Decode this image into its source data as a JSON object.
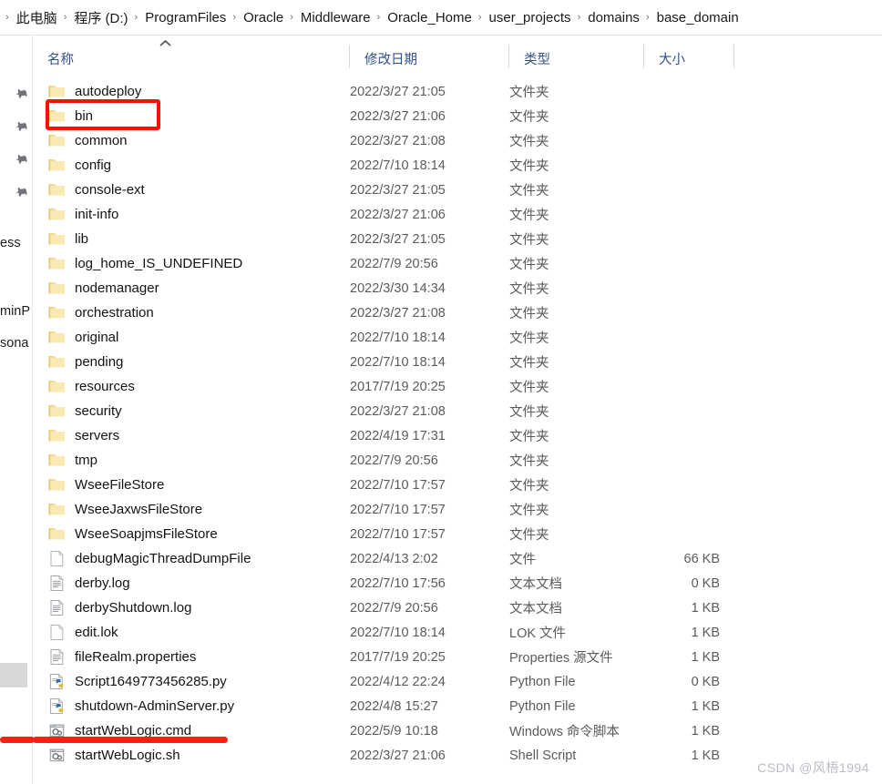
{
  "breadcrumb": {
    "separator": "›",
    "items": [
      "此电脑",
      "程序 (D:)",
      "ProgramFiles",
      "Oracle",
      "Middleware",
      "Oracle_Home",
      "user_projects",
      "domains",
      "base_domain"
    ]
  },
  "nav_pane": {
    "pin_icon": "pin-icon",
    "pin_count": 4,
    "fragments": [
      "ess",
      "minP",
      "sona"
    ]
  },
  "columns": {
    "name": "名称",
    "date_modified": "修改日期",
    "type": "类型",
    "size": "大小",
    "sort_arrow": "︿"
  },
  "files": [
    {
      "name": "autodeploy",
      "icon": "folder-icon",
      "date": "2022/3/27 21:05",
      "type": "文件夹",
      "size": ""
    },
    {
      "name": "bin",
      "icon": "folder-icon",
      "date": "2022/3/27 21:06",
      "type": "文件夹",
      "size": ""
    },
    {
      "name": "common",
      "icon": "folder-icon",
      "date": "2022/3/27 21:08",
      "type": "文件夹",
      "size": ""
    },
    {
      "name": "config",
      "icon": "folder-icon",
      "date": "2022/7/10 18:14",
      "type": "文件夹",
      "size": ""
    },
    {
      "name": "console-ext",
      "icon": "folder-icon",
      "date": "2022/3/27 21:05",
      "type": "文件夹",
      "size": ""
    },
    {
      "name": "init-info",
      "icon": "folder-icon",
      "date": "2022/3/27 21:06",
      "type": "文件夹",
      "size": ""
    },
    {
      "name": "lib",
      "icon": "folder-icon",
      "date": "2022/3/27 21:05",
      "type": "文件夹",
      "size": ""
    },
    {
      "name": "log_home_IS_UNDEFINED",
      "icon": "folder-icon",
      "date": "2022/7/9 20:56",
      "type": "文件夹",
      "size": ""
    },
    {
      "name": "nodemanager",
      "icon": "folder-icon",
      "date": "2022/3/30 14:34",
      "type": "文件夹",
      "size": ""
    },
    {
      "name": "orchestration",
      "icon": "folder-icon",
      "date": "2022/3/27 21:08",
      "type": "文件夹",
      "size": ""
    },
    {
      "name": "original",
      "icon": "folder-icon",
      "date": "2022/7/10 18:14",
      "type": "文件夹",
      "size": ""
    },
    {
      "name": "pending",
      "icon": "folder-icon",
      "date": "2022/7/10 18:14",
      "type": "文件夹",
      "size": ""
    },
    {
      "name": "resources",
      "icon": "folder-icon",
      "date": "2017/7/19 20:25",
      "type": "文件夹",
      "size": ""
    },
    {
      "name": "security",
      "icon": "folder-icon",
      "date": "2022/3/27 21:08",
      "type": "文件夹",
      "size": ""
    },
    {
      "name": "servers",
      "icon": "folder-icon",
      "date": "2022/4/19 17:31",
      "type": "文件夹",
      "size": ""
    },
    {
      "name": "tmp",
      "icon": "folder-icon",
      "date": "2022/7/9 20:56",
      "type": "文件夹",
      "size": ""
    },
    {
      "name": "WseeFileStore",
      "icon": "folder-icon",
      "date": "2022/7/10 17:57",
      "type": "文件夹",
      "size": ""
    },
    {
      "name": "WseeJaxwsFileStore",
      "icon": "folder-icon",
      "date": "2022/7/10 17:57",
      "type": "文件夹",
      "size": ""
    },
    {
      "name": "WseeSoapjmsFileStore",
      "icon": "folder-icon",
      "date": "2022/7/10 17:57",
      "type": "文件夹",
      "size": ""
    },
    {
      "name": "debugMagicThreadDumpFile",
      "icon": "blank-file-icon",
      "date": "2022/4/13 2:02",
      "type": "文件",
      "size": "66 KB"
    },
    {
      "name": "derby.log",
      "icon": "text-file-icon",
      "date": "2022/7/10 17:56",
      "type": "文本文档",
      "size": "0 KB"
    },
    {
      "name": "derbyShutdown.log",
      "icon": "text-file-icon",
      "date": "2022/7/9 20:56",
      "type": "文本文档",
      "size": "1 KB"
    },
    {
      "name": "edit.lok",
      "icon": "blank-file-icon",
      "date": "2022/7/10 18:14",
      "type": "LOK 文件",
      "size": "1 KB"
    },
    {
      "name": "fileRealm.properties",
      "icon": "text-file-icon",
      "date": "2017/7/19 20:25",
      "type": "Properties 源文件",
      "size": "1 KB"
    },
    {
      "name": "Script1649773456285.py",
      "icon": "python-file-icon",
      "date": "2022/4/12 22:24",
      "type": "Python File",
      "size": "0 KB"
    },
    {
      "name": "shutdown-AdminServer.py",
      "icon": "python-file-icon",
      "date": "2022/4/8 15:27",
      "type": "Python File",
      "size": "1 KB"
    },
    {
      "name": "startWebLogic.cmd",
      "icon": "script-file-icon",
      "date": "2022/5/9 10:18",
      "type": "Windows 命令脚本",
      "size": "1 KB"
    },
    {
      "name": "startWebLogic.sh",
      "icon": "script-file-icon",
      "date": "2022/3/27 21:06",
      "type": "Shell Script",
      "size": "1 KB"
    }
  ],
  "annotations": {
    "highlight_rect_target": "bin",
    "underline_target": "startWebLogic.cmd",
    "accent_color": "#fb1000"
  },
  "watermark": {
    "text": "CSDN @风梧1994",
    "color": "#b9bcc2"
  }
}
